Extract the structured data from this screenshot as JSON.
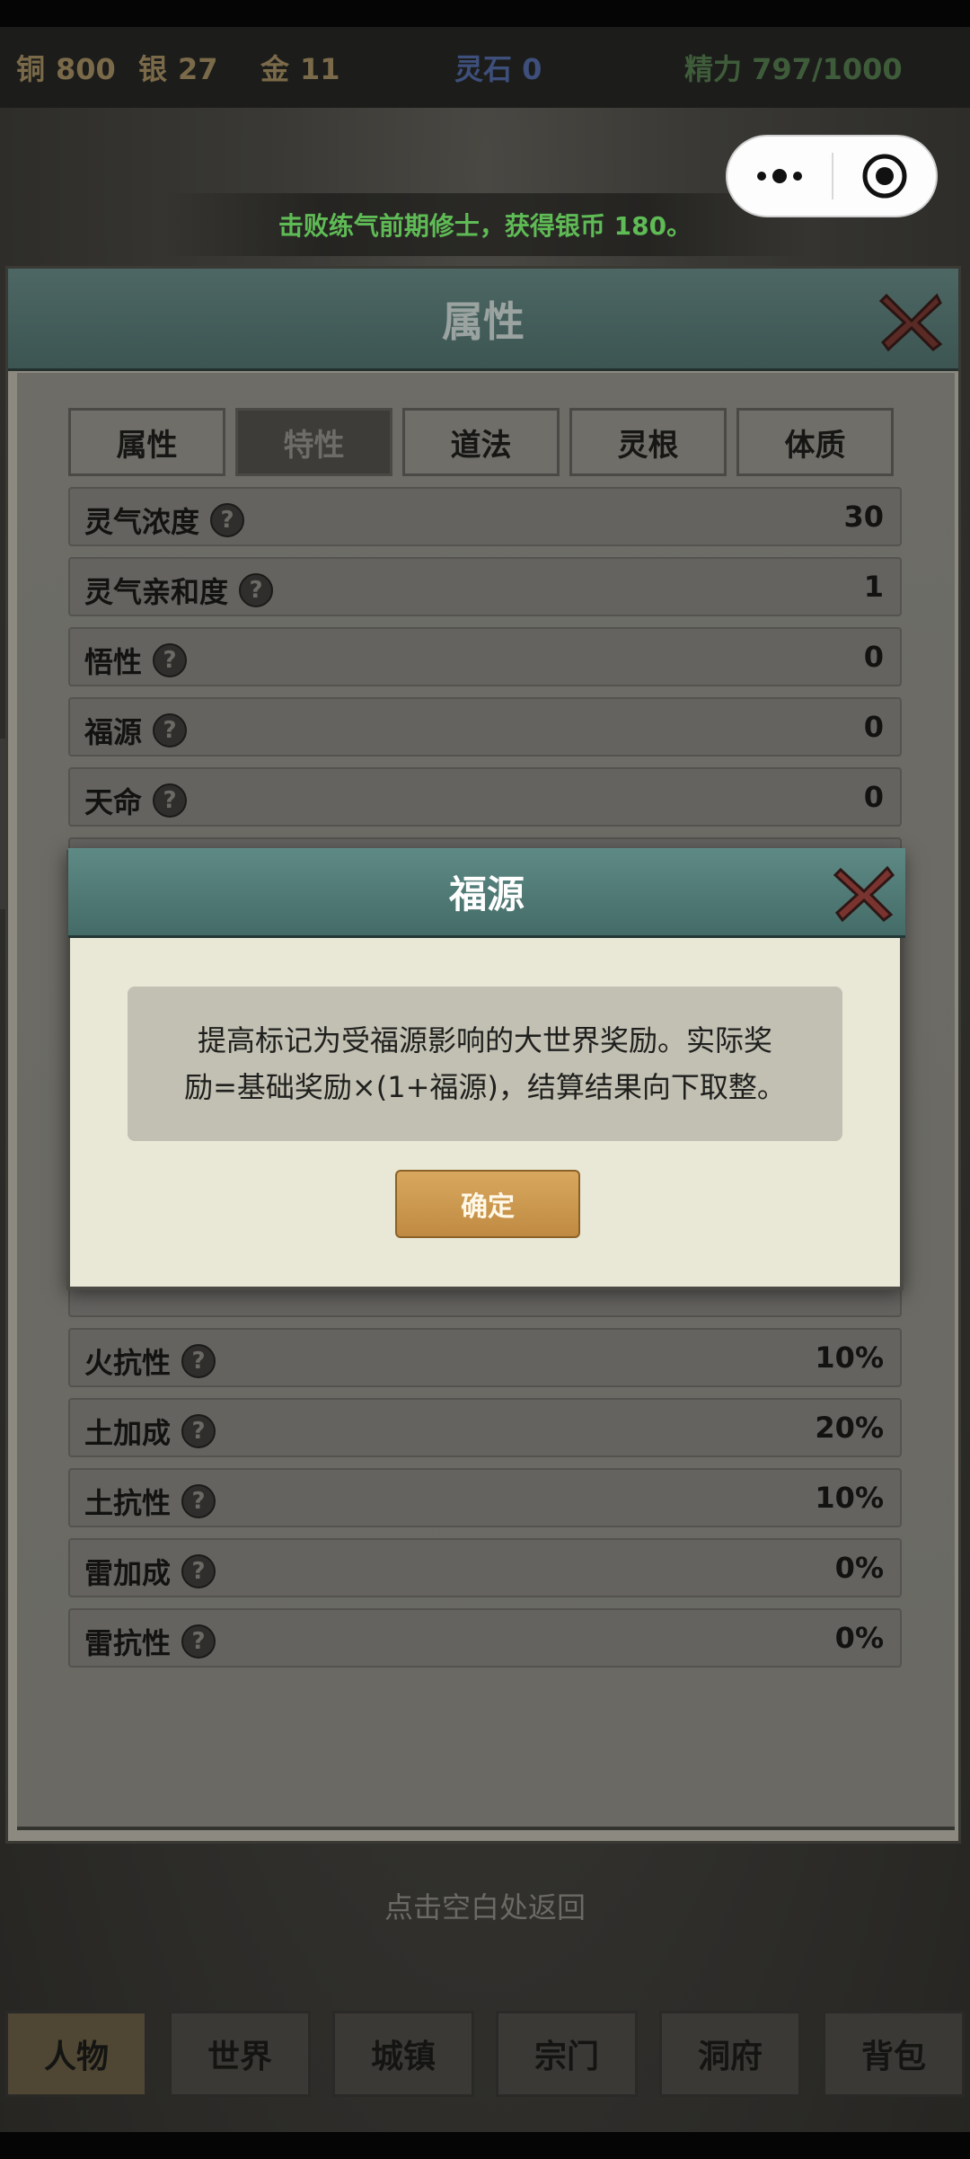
{
  "currency": {
    "copper_label": "铜",
    "copper_value": "800",
    "silver_label": "银",
    "silver_value": "27",
    "gold_label": "金",
    "gold_value": "11",
    "spirit_stone": "灵石 0",
    "energy": "精力 797/1000"
  },
  "notice": "击败练气前期修士，获得银币 180。",
  "panel": {
    "title": "属性",
    "tabs": [
      "属性",
      "特性",
      "道法",
      "灵根",
      "体质"
    ],
    "active_tab": "特性",
    "rows_top": [
      {
        "label": "灵气浓度",
        "value": "30"
      },
      {
        "label": "灵气亲和度",
        "value": "1"
      },
      {
        "label": "悟性",
        "value": "0"
      },
      {
        "label": "福源",
        "value": "0"
      },
      {
        "label": "天命",
        "value": "0"
      }
    ],
    "rows_bottom": [
      {
        "label": "火抗性",
        "value": "10%"
      },
      {
        "label": "土加成",
        "value": "20%"
      },
      {
        "label": "土抗性",
        "value": "10%"
      },
      {
        "label": "雷加成",
        "value": "0%"
      },
      {
        "label": "雷抗性",
        "value": "0%"
      }
    ]
  },
  "hint": "点击空白处返回",
  "nav": [
    "人物",
    "世界",
    "城镇",
    "宗门",
    "洞府",
    "背包"
  ],
  "modal": {
    "title": "福源",
    "text_line1": "提高标记为受福源影响的大世界奖励。实际奖",
    "text_line2": "励=基础奖励×(1+福源)，结算结果向下取整。",
    "confirm": "确定"
  },
  "icons": {
    "qmark": "?",
    "close": "close-x-icon"
  },
  "colors": {
    "notice_green": "#5fbb55",
    "header_teal": "#446b67",
    "confirm_gold": "#c08a42"
  }
}
